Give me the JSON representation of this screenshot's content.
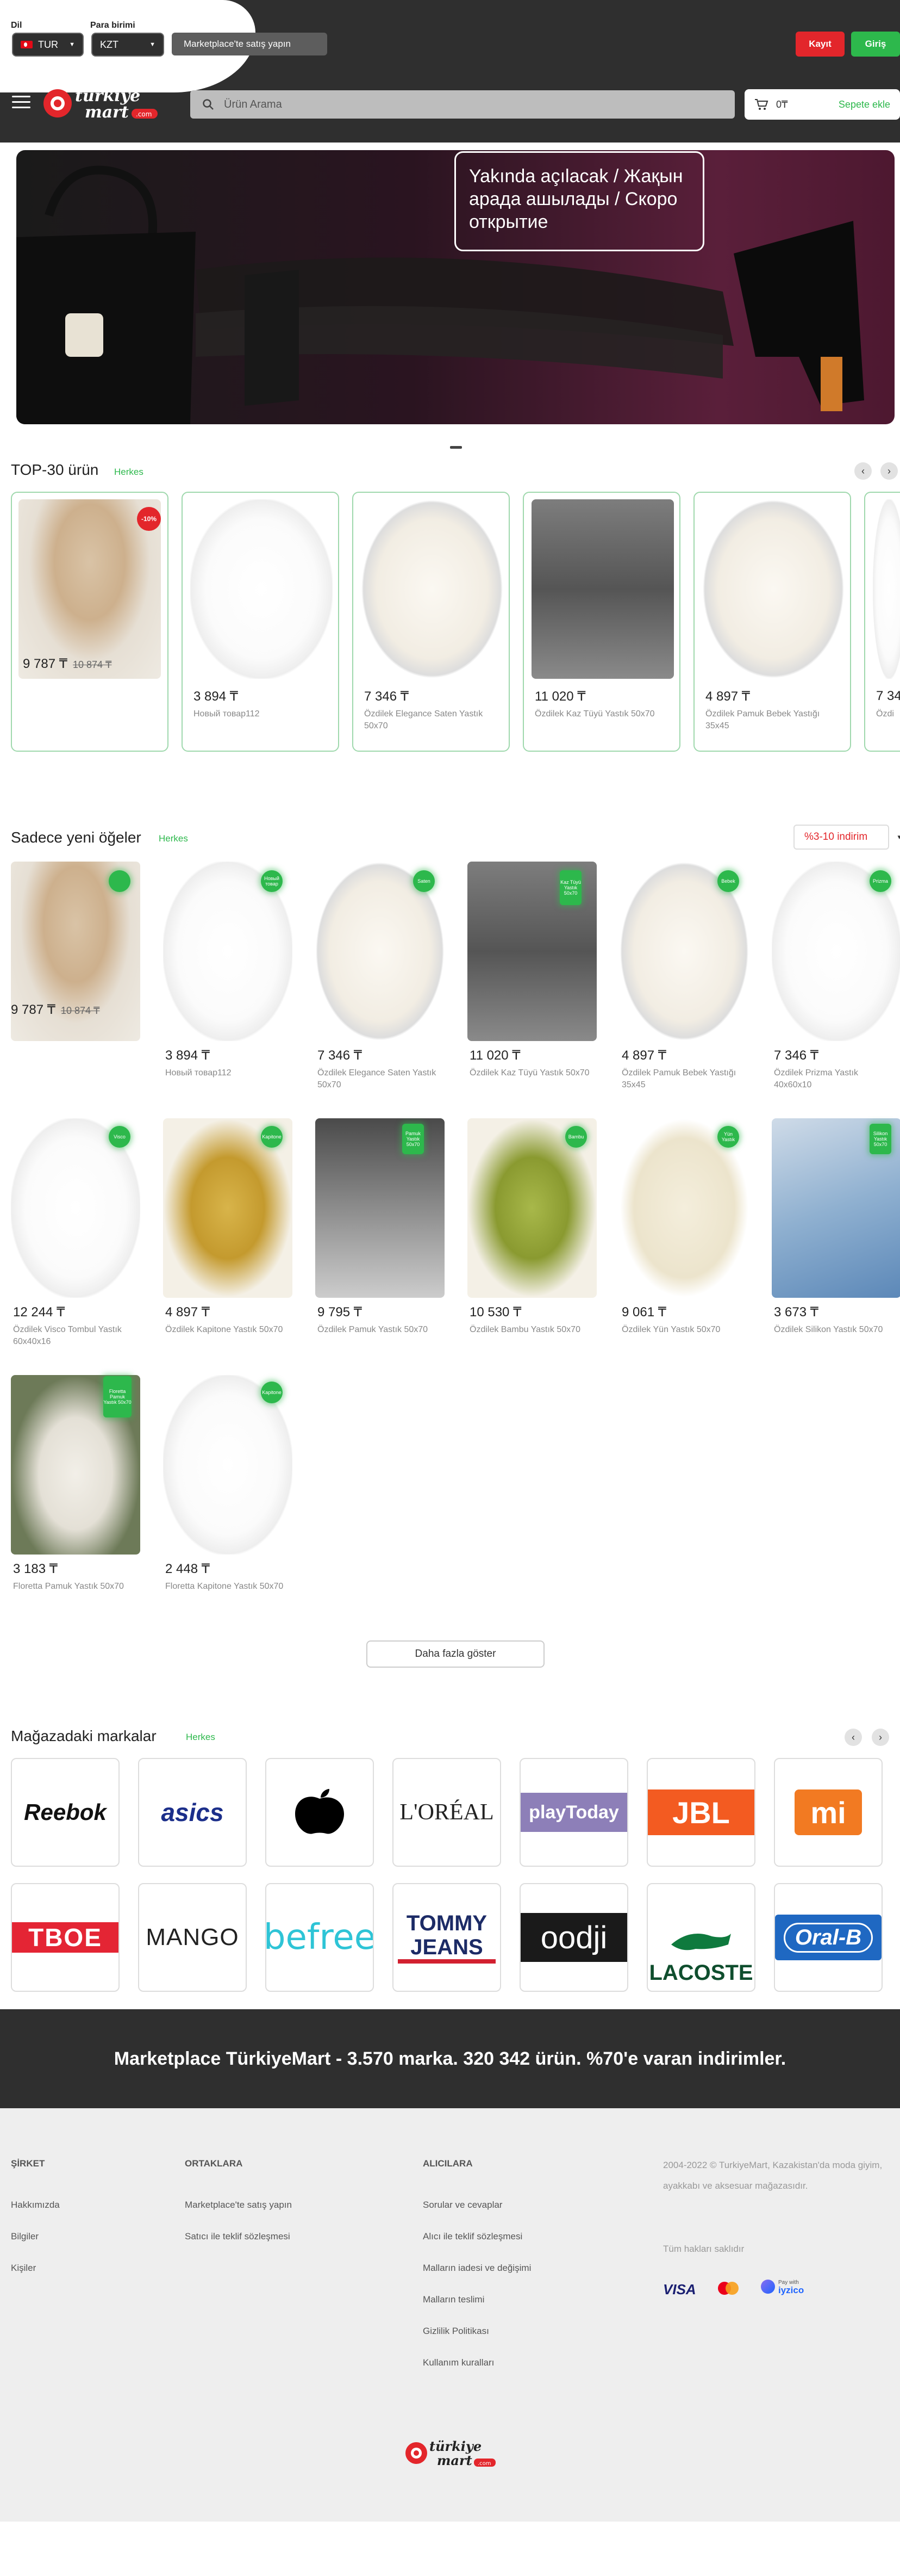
{
  "header": {
    "language_label": "Dil",
    "language_value": "TUR",
    "currency_label": "Para birimi",
    "currency_value": "KZT",
    "sell_button": "Marketplace'te satış yapın",
    "register_button": "Kayıt",
    "login_button": "Giriş",
    "logo_top": "türkiye",
    "logo_bottom": "mart",
    "logo_tag": ".com",
    "search_placeholder": "Ürün Arama",
    "cart_amount": "0₸",
    "cart_add": "Sepete ekle"
  },
  "hero": {
    "text": "Yakında açılacak / Жақын арада ашылады / Скоро открытие"
  },
  "top30": {
    "title": "TOP-30 ürün",
    "link": "Herkes",
    "items": [
      {
        "price": "9 787 ₸",
        "old_price": "10 874 ₸",
        "name": "",
        "badge": "-10%"
      },
      {
        "price": "3 894 ₸",
        "name": "Новый товар112"
      },
      {
        "price": "7 346 ₸",
        "name": "Özdilek Elegance Saten Yastık 50x70"
      },
      {
        "price": "11 020 ₸",
        "name": "Özdilek Kaz Tüyü Yastık 50x70"
      },
      {
        "price": "4 897 ₸",
        "name": "Özdilek Pamuk Bebek Yastığı 35x45"
      },
      {
        "price": "7 34",
        "name": "Özdi"
      }
    ]
  },
  "newitems": {
    "title": "Sadece yeni öğeler",
    "link": "Herkes",
    "sort": "%3-10 indirim",
    "items": [
      {
        "price": "9 787 ₸",
        "old_price": "10 874 ₸",
        "name": "",
        "badge": ""
      },
      {
        "price": "3 894 ₸",
        "name": "Новый товар112",
        "badge": "Новый товар"
      },
      {
        "price": "7 346 ₸",
        "name": "Özdilek Elegance Saten Yastık 50x70",
        "badge": "Saten"
      },
      {
        "price": "11 020 ₸",
        "name": "Özdilek Kaz Tüyü Yastık 50x70",
        "badge": "Kaz Tüyü Yastık 50x70"
      },
      {
        "price": "4 897 ₸",
        "name": "Özdilek Pamuk Bebek Yastığı 35x45",
        "badge": "Bebek"
      },
      {
        "price": "7 346 ₸",
        "name": "Özdilek Prizma Yastık 40x60x10",
        "badge": "Prizma"
      },
      {
        "price": "12 244 ₸",
        "name": "Özdilek Visco Tombul Yastık 60x40x16",
        "badge": "Visco"
      },
      {
        "price": "4 897 ₸",
        "name": "Özdilek Kapitone Yastık 50x70",
        "badge": "Kapitone"
      },
      {
        "price": "9 795 ₸",
        "name": "Özdilek Pamuk Yastık 50x70",
        "badge": "Pamuk Yastık 50x70"
      },
      {
        "price": "10 530 ₸",
        "name": "Özdilek Bambu Yastık 50x70",
        "badge": "Bambu"
      },
      {
        "price": "9 061 ₸",
        "name": "Özdilek Yün Yastık 50x70",
        "badge": "Yün Yastık"
      },
      {
        "price": "3 673 ₸",
        "name": "Özdilek Silikon Yastık 50x70",
        "badge": "Silikon Yastık 50x70"
      },
      {
        "price": "3 183 ₸",
        "name": "Floretta Pamuk Yastık 50x70",
        "badge": "Floretta Pamuk Yastık 50x70"
      },
      {
        "price": "2 448 ₸",
        "name": "Floretta Kapitone Yastık 50x70",
        "badge": "Kapitone"
      }
    ],
    "more_button": "Daha fazla göster"
  },
  "brands": {
    "title": "Mağazadaki markalar",
    "link": "Herkes",
    "items": [
      "Reebok",
      "asics",
      "Apple",
      "L'ORÉAL",
      "playToday",
      "JBL",
      "mi",
      "TBOE",
      "MANGO",
      "befree",
      "TOMMY JEANS",
      "oodji",
      "LACOSTE",
      "Oral-B"
    ]
  },
  "banner": {
    "text": "Marketplace TürkiyeMart - 3.570 marka. 320 342 ürün. %70'e varan indirimler."
  },
  "footer": {
    "col1_title": "ŞİRKET",
    "col1_links": [
      "Hakkımızda",
      "Bilgiler",
      "Kişiler"
    ],
    "col2_title": "ORTAKLARA",
    "col2_links": [
      "Marketplace'te satış yapın",
      "Satıcı ile teklif sözleşmesi"
    ],
    "col3_title": "ALICILARA",
    "col3_links": [
      "Sorular ve cevaplar",
      "Alıcı ile teklif sözleşmesi",
      "Malların iadesi ve değişimi",
      "Malların teslimi",
      "Gizlilik Politikası",
      "Kullanım kuralları"
    ],
    "about": "2004-2022 © TurkiyeMart, Kazakistan'da moda giyim, ayakkabı ve aksesuar mağazasıdır.",
    "rights": "Tüm hakları saklıdır",
    "pay_visa": "VISA",
    "pay_iyzico": "iyzico",
    "pay_iyzico_small": "Pay with"
  },
  "colors": {
    "accent_green": "#2db84c",
    "accent_red": "#e3262b",
    "dark": "#2f2f2f"
  }
}
